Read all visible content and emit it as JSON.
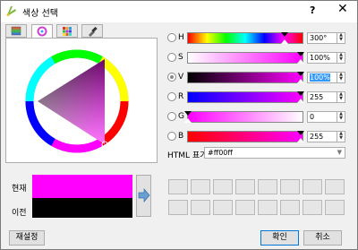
{
  "window": {
    "title": "색상 선택",
    "help": "?",
    "close": "✕"
  },
  "tabs": [
    {
      "icon": "color-ramp-icon"
    },
    {
      "icon": "color-wheel-icon"
    },
    {
      "icon": "swatch-grid-icon"
    },
    {
      "icon": "color-picker-icon"
    }
  ],
  "channels": [
    {
      "label": "H",
      "value": "300°",
      "selected": false
    },
    {
      "label": "S",
      "value": "100%",
      "selected": false
    },
    {
      "label": "V",
      "value": "100%",
      "selected": true
    },
    {
      "label": "R",
      "value": "255",
      "selected": false
    },
    {
      "label": "G",
      "value": "0",
      "selected": false
    },
    {
      "label": "B",
      "value": "255",
      "selected": false
    }
  ],
  "html": {
    "label": "HTML 표기",
    "value": "#ff00ff"
  },
  "preview": {
    "current_label": "현재",
    "previous_label": "이전",
    "current_color": "#ff00ff",
    "previous_color": "#000000"
  },
  "buttons": {
    "reset": "재설정",
    "ok": "확인",
    "cancel": "취소"
  },
  "colors": {
    "accent": "#0078d7",
    "current": "#ff00ff"
  }
}
